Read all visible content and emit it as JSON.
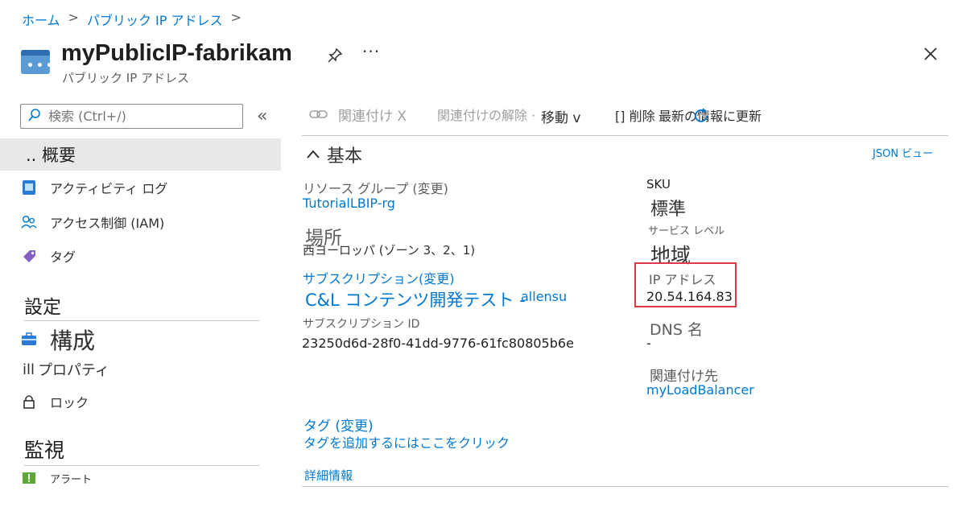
{
  "breadcrumb": {
    "home": "ホーム",
    "sep": ">",
    "parent": "パブリック IP アドレス"
  },
  "header": {
    "title": "myPublicIP-fabrikam",
    "subtitle": "パブリック IP アドレス",
    "more": "···"
  },
  "search": {
    "placeholder": "検索 (Ctrl+/)",
    "collapse": "«"
  },
  "sidebar": {
    "overview_label": ".. 概要",
    "activity_log_label": "アクティビティ ログ",
    "access_control_label": "アクセス制御 (IAM)",
    "tags_label": "タグ",
    "settings_header": "設定",
    "configuration_label": "構成",
    "properties_icon": "ill",
    "properties_label": "プロパティ",
    "locks_label": "ロック",
    "monitoring_header": "監視",
    "alerts_label": "アラート"
  },
  "toolbar": {
    "associate_label": "関連付け X",
    "dissociate_label": "関連付けの解除 ·",
    "move_label": "移動 v",
    "delete_label": "[] 削除",
    "refresh_label": "最新の情報に更新"
  },
  "essentials": {
    "header": "基本",
    "json_view": "JSON ビュー",
    "resource_group_label": "リソース グループ (変更)",
    "resource_group_value": "TutorialLBIP-rg",
    "location_label": "場所",
    "location_value": "西ヨーロッパ (ゾーン 3、2、1)",
    "subscription_label": "サブスクリプション(変更)",
    "subscription_value": "C&L コンテンツ開発テスト -",
    "subscription_extra": "allensu",
    "subscription_id_label": "サブスクリプション ID",
    "subscription_id_value": "23250d6d-28f0-41dd-9776-61fc80805b6e",
    "sku_label": "SKU",
    "sku_value": "標準",
    "tier_label": "サービス レベル",
    "tier_value": "地域",
    "ip_label": "IP アドレス",
    "ip_value": "20.54.164.83",
    "dns_label": "DNS 名",
    "dns_value": "-",
    "associated_label": "関連付け先",
    "associated_value": "myLoadBalancer",
    "tags_label": "タグ (変更)",
    "tags_add": "タグを追加するにはここをクリック",
    "more_info": "詳細情報"
  },
  "colors": {
    "link": "#0078d4",
    "highlight": "#e0374b",
    "selected_nav": "#e8e8e8"
  }
}
